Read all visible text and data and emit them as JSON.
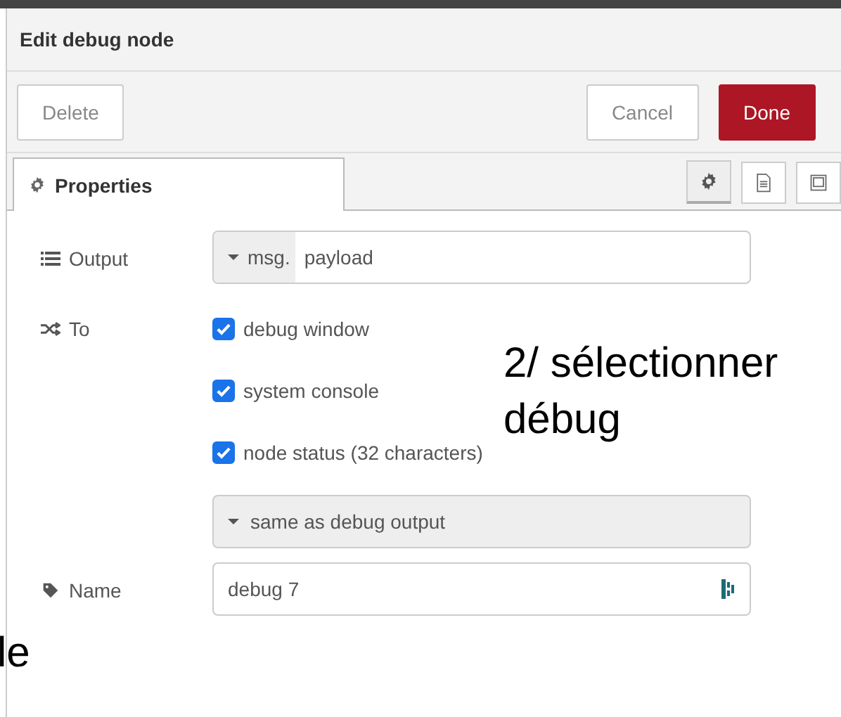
{
  "dialog": {
    "title": "Edit debug node"
  },
  "buttons": [
    {
      "label": "Delete",
      "kind": "plain"
    },
    {
      "label": "Cancel",
      "kind": "plain"
    },
    {
      "label": "Done",
      "kind": "primary"
    }
  ],
  "tabs": [
    {
      "label": "Properties",
      "selected": true
    }
  ],
  "icon_tabs": [
    {
      "kind": "gear",
      "selected": true
    },
    {
      "kind": "document",
      "selected": false
    },
    {
      "kind": "frame",
      "selected": false
    }
  ],
  "output": {
    "label": "Output",
    "prefix": "msg.",
    "value": "payload"
  },
  "to": {
    "label": "To",
    "options": [
      {
        "label": "debug window",
        "checked": true
      },
      {
        "label": "system console",
        "checked": true
      },
      {
        "label": "node status (32 characters)",
        "checked": true
      }
    ],
    "status_select": "same as debug output"
  },
  "name": {
    "label": "Name",
    "value": "debug 7"
  },
  "annotations": [
    {
      "text": "2/ sélectionner",
      "kind": "right"
    },
    {
      "text": "débug",
      "kind": "right2"
    },
    {
      "text": "le",
      "kind": "left"
    }
  ]
}
